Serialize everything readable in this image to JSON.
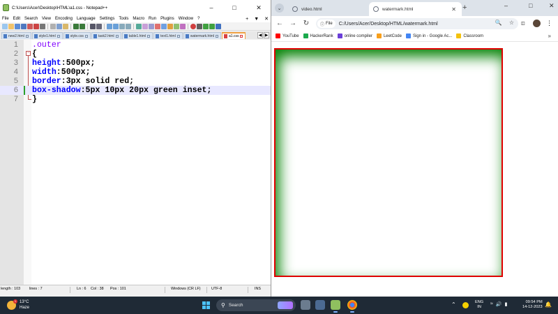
{
  "npp": {
    "title": "C:\\Users\\Acer\\Desktop\\HTML\\a1.css - Notepad++",
    "menu": [
      "File",
      "Edit",
      "Search",
      "View",
      "Encoding",
      "Language",
      "Settings",
      "Tools",
      "Macro",
      "Run",
      "Plugins",
      "Window",
      "?"
    ],
    "menu_right": [
      "+",
      "▼",
      "✕"
    ],
    "tabs": [
      "new2.html",
      "style1.html",
      "style.css",
      "task2.html",
      "table1.html",
      "text1.html",
      "watermark.html",
      "a1.css"
    ],
    "active_tab": "a1.css",
    "lines": [
      {
        "num": "1",
        "selector": ".outer"
      },
      {
        "num": "2",
        "brace": "{"
      },
      {
        "num": "3",
        "prop": "height",
        "value": "500px"
      },
      {
        "num": "4",
        "prop": "width",
        "value": "500px"
      },
      {
        "num": "5",
        "prop": "border",
        "value": "3px solid red"
      },
      {
        "num": "6",
        "prop": "box-shadow",
        "value": "5px 10px 20px green inset"
      },
      {
        "num": "7",
        "brace": "}"
      }
    ],
    "status": {
      "length": "length : 103",
      "lines": "lines : 7",
      "ln": "Ln : 6",
      "col": "Col : 38",
      "pos": "Pos : 101",
      "eol": "Windows (CR LF)",
      "encoding": "UTF-8",
      "mode": "INS"
    }
  },
  "chrome": {
    "tabs": [
      {
        "title": "video.html"
      },
      {
        "title": "watermark.html"
      }
    ],
    "file_chip": "File",
    "url": "C:/Users/Acer/Desktop/HTML/watermark.html",
    "bookmarks": [
      {
        "label": "YouTube",
        "color": "#ff0000"
      },
      {
        "label": "HackerRank",
        "color": "#1ba94c"
      },
      {
        "label": "online compiler",
        "color": "#6b3fd8"
      },
      {
        "label": "LeetCode",
        "color": "#f89f1b"
      },
      {
        "label": "Sign in - Google Ac...",
        "color": "#4285f4"
      },
      {
        "label": "Classroom",
        "color": "#f4c20d"
      }
    ],
    "box": {
      "border_color": "#e00000",
      "shadow_color": "green"
    }
  },
  "taskbar": {
    "weather_temp": "13°C",
    "weather_desc": "Haze",
    "weather_badge": "1",
    "search_label": "Search",
    "lang_line1": "ENG",
    "lang_line2": "IN",
    "time": "09:54 PM",
    "date": "14-12-2023"
  }
}
